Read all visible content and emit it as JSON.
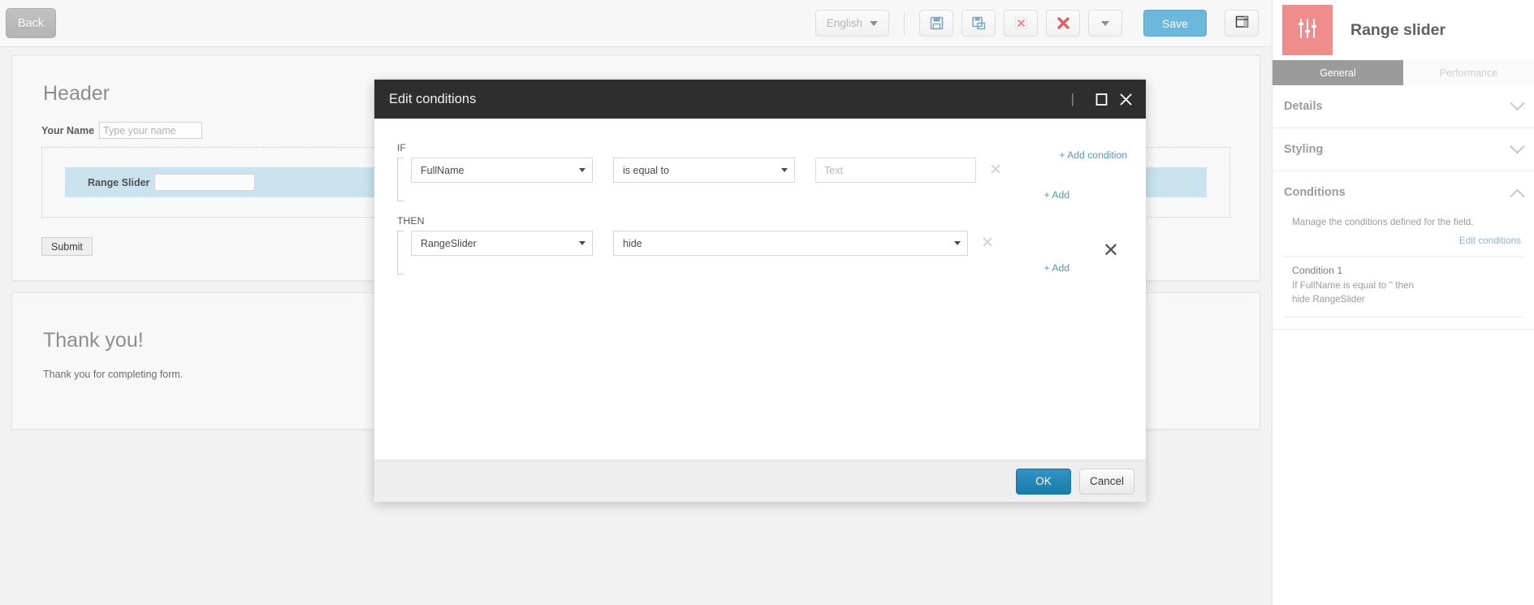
{
  "toolbar": {
    "back_label": "Back",
    "language_value": "English",
    "save_label": "Save",
    "icons": [
      {
        "name": "save-icon",
        "title": "Save"
      },
      {
        "name": "save-as-icon",
        "title": "Save as"
      },
      {
        "name": "delete-dotted-icon",
        "title": "Delete"
      },
      {
        "name": "delete-icon",
        "title": "Remove"
      },
      {
        "name": "more-caret-icon",
        "title": "More"
      }
    ],
    "panel_toggle_name": "panel-layout-icon"
  },
  "form": {
    "header": "Header",
    "name_label": "Your Name",
    "name_placeholder": "Type your name",
    "name_value": "",
    "slider_label": "Range Slider",
    "slider_value": "",
    "submit_label": "Submit",
    "thanks_title": "Thank you!",
    "thanks_text": "Thank you for completing form."
  },
  "sidebar": {
    "title": "Range slider",
    "badge_icon": "range-slider-icon",
    "tabs": [
      {
        "label": "General",
        "active": true
      },
      {
        "label": "Performance",
        "active": false
      }
    ],
    "sections": [
      {
        "label": "Details",
        "expanded": false
      },
      {
        "label": "Styling",
        "expanded": false
      },
      {
        "label": "Conditions",
        "expanded": true
      }
    ],
    "conditions": {
      "description": "Manage the conditions defined for the field.",
      "edit_link": "Edit conditions",
      "items": [
        {
          "name": "Condition 1",
          "line1": "If FullName is equal to '' then",
          "line2": "hide RangeSlider"
        }
      ]
    }
  },
  "modal": {
    "title": "Edit conditions",
    "maximize_icon": "maximize-icon",
    "close_icon": "close-icon",
    "add_condition_label": "+ Add condition",
    "if_label": "IF",
    "then_label": "THEN",
    "if_row": {
      "field_value": "FullName",
      "operator_value": "is equal to",
      "value_text": "",
      "value_placeholder": "Text",
      "remove_icon": "remove-row-icon"
    },
    "if_add_label": "+ Add",
    "then_row": {
      "field_value": "RangeSlider",
      "action_value": "hide",
      "remove_icon": "remove-row-icon"
    },
    "then_add_label": "+ Add",
    "group_remove_icon": "remove-condition-icon",
    "ok_label": "OK",
    "cancel_label": "Cancel"
  },
  "colors": {
    "accent_blue": "#5796c0",
    "save_blue": "#6cb8dd",
    "ok_blue": "#1a7ca8",
    "badge_red": "#ef8c8c",
    "slider_highlight": "#c9e4ef",
    "modal_titlebar": "#2e2e2e"
  }
}
